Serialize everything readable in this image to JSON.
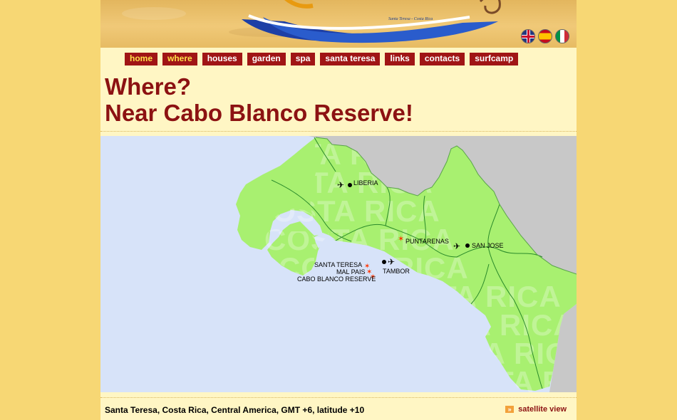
{
  "nav": [
    {
      "label": "home",
      "active": true
    },
    {
      "label": "where",
      "active": false
    },
    {
      "label": "houses",
      "active": false
    },
    {
      "label": "garden",
      "active": false
    },
    {
      "label": "spa",
      "active": false
    },
    {
      "label": "santa teresa",
      "active": false
    },
    {
      "label": "links",
      "active": false
    },
    {
      "label": "contacts",
      "active": false
    },
    {
      "label": "surfcamp",
      "active": false
    }
  ],
  "languages": [
    "english",
    "spanish",
    "italian"
  ],
  "logo": {
    "tagline": "Santa Teresa - Costa Rica"
  },
  "title": {
    "line1": "Where?",
    "line2": "Near Cabo Blanco Reserve!"
  },
  "map": {
    "watermark": "COSTA RICA",
    "places": {
      "liberia": "LIBERIA",
      "puntarenas": "PUNTARENAS",
      "san_jose": "SAN JOSE",
      "santa_teresa": "SANTA TERESA",
      "mal_pais": "MAL PAIS",
      "tambor": "TAMBOR",
      "cabo_blanco": "CABO BLANCO RESERVE"
    }
  },
  "footer": {
    "info": "Santa Teresa, Costa Rica, Central America, GMT +6, latitude +10",
    "satellite_label": "satellite view"
  },
  "colors": {
    "background": "#f7d774",
    "page": "#fff6c4",
    "nav": "#a01515",
    "active_nav_text": "#ffe14a",
    "title": "#8c1212",
    "land": "#a8f070",
    "sea": "#d7e3f9",
    "neighbor": "#c8c8c8"
  }
}
